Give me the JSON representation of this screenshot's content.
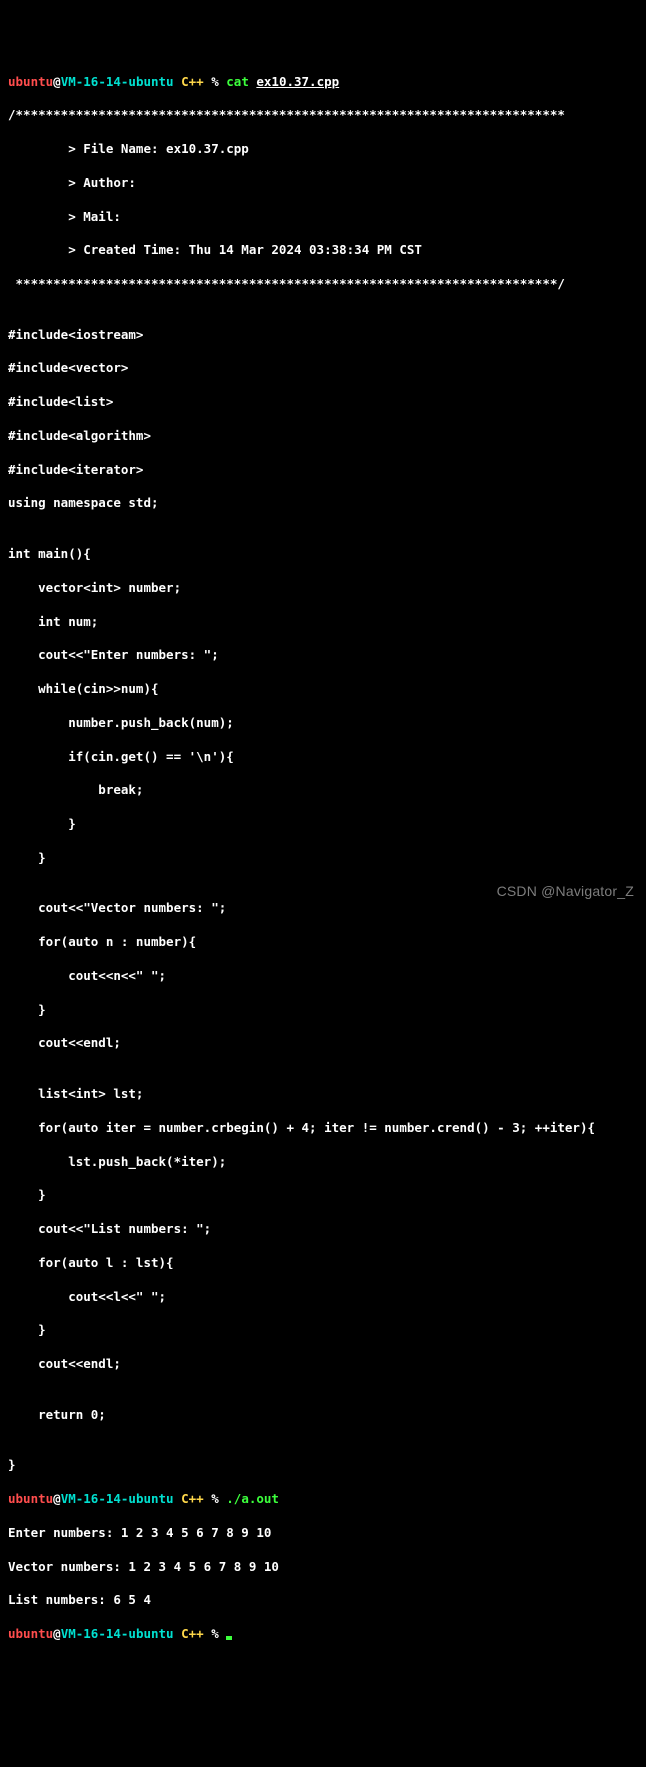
{
  "prompt1": {
    "user": "ubuntu",
    "at": "@",
    "host": "VM-16-14-ubuntu",
    "dir": " C++",
    "pct": " % ",
    "cmd": "cat ",
    "file": "ex10.37.cpp"
  },
  "src": [
    "/*************************************************************************",
    "        > File Name: ex10.37.cpp",
    "        > Author:",
    "        > Mail:",
    "        > Created Time: Thu 14 Mar 2024 03:38:34 PM CST",
    " ************************************************************************/",
    "",
    "#include<iostream>",
    "#include<vector>",
    "#include<list>",
    "#include<algorithm>",
    "#include<iterator>",
    "using namespace std;",
    "",
    "int main(){",
    "    vector<int> number;",
    "    int num;",
    "    cout<<\"Enter numbers: \";",
    "    while(cin>>num){",
    "        number.push_back(num);",
    "        if(cin.get() == '\\n'){",
    "            break;",
    "        }",
    "    }",
    "",
    "    cout<<\"Vector numbers: \";",
    "    for(auto n : number){",
    "        cout<<n<<\" \";",
    "    }",
    "    cout<<endl;",
    "",
    "    list<int> lst;",
    "    for(auto iter = number.crbegin() + 4; iter != number.crend() - 3; ++iter){",
    "        lst.push_back(*iter);",
    "    }",
    "    cout<<\"List numbers: \";",
    "    for(auto l : lst){",
    "        cout<<l<<\" \";",
    "    }",
    "    cout<<endl;",
    "",
    "    return 0;",
    "",
    "}"
  ],
  "prompt2": {
    "user": "ubuntu",
    "at": "@",
    "host": "VM-16-14-ubuntu",
    "dir": " C++",
    "pct": " % ",
    "cmd": "./a.out"
  },
  "out": [
    "Enter numbers: 1 2 3 4 5 6 7 8 9 10",
    "Vector numbers: 1 2 3 4 5 6 7 8 9 10",
    "List numbers: 6 5 4"
  ],
  "prompt3": {
    "user": "ubuntu",
    "at": "@",
    "host": "VM-16-14-ubuntu",
    "dir": " C++",
    "pct": " % "
  },
  "watermark": "CSDN @Navigator_Z"
}
